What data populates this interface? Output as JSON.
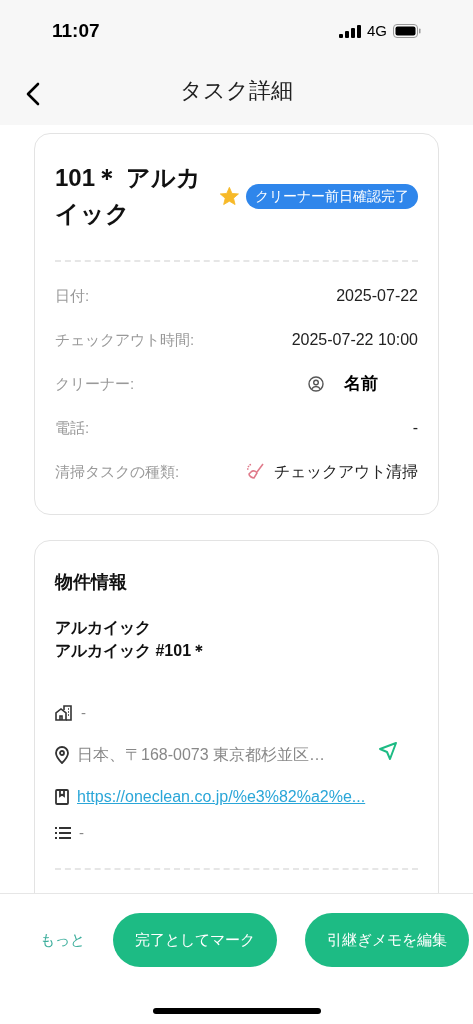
{
  "status_bar": {
    "time": "11:07",
    "network": "4G"
  },
  "header": {
    "title": "タスク詳細"
  },
  "task_card": {
    "title": "101＊ アルカイック",
    "starred": true,
    "badge": "クリーナー前日確認完了",
    "rows": [
      {
        "kind": "text",
        "label": "日付:",
        "value": "2025-07-22"
      },
      {
        "kind": "text",
        "label": "チェックアウト時間:",
        "value": "2025-07-22 10:00"
      },
      {
        "kind": "person",
        "label": "クリーナー:",
        "value": "名前"
      },
      {
        "kind": "text",
        "label": "電話:",
        "value": "-"
      },
      {
        "kind": "cleaning",
        "label": "清掃タスクの種類:",
        "value": "チェックアウト清掃"
      }
    ]
  },
  "property_card": {
    "title": "物件情報",
    "name_lines": [
      "アルカイック",
      "アルカイック #101＊"
    ],
    "rows": [
      {
        "kind": "building",
        "value": "-"
      },
      {
        "kind": "address",
        "value": "日本、〒168-0073 東京都杉並区…"
      },
      {
        "kind": "link",
        "value": "https://oneclean.co.jp/%e3%82%a2%e..."
      },
      {
        "kind": "notes",
        "value": "-"
      }
    ]
  },
  "bottom_bar": {
    "more": "もっと",
    "buttons": [
      "完了としてマーク",
      "引継ぎメモを編集"
    ]
  }
}
